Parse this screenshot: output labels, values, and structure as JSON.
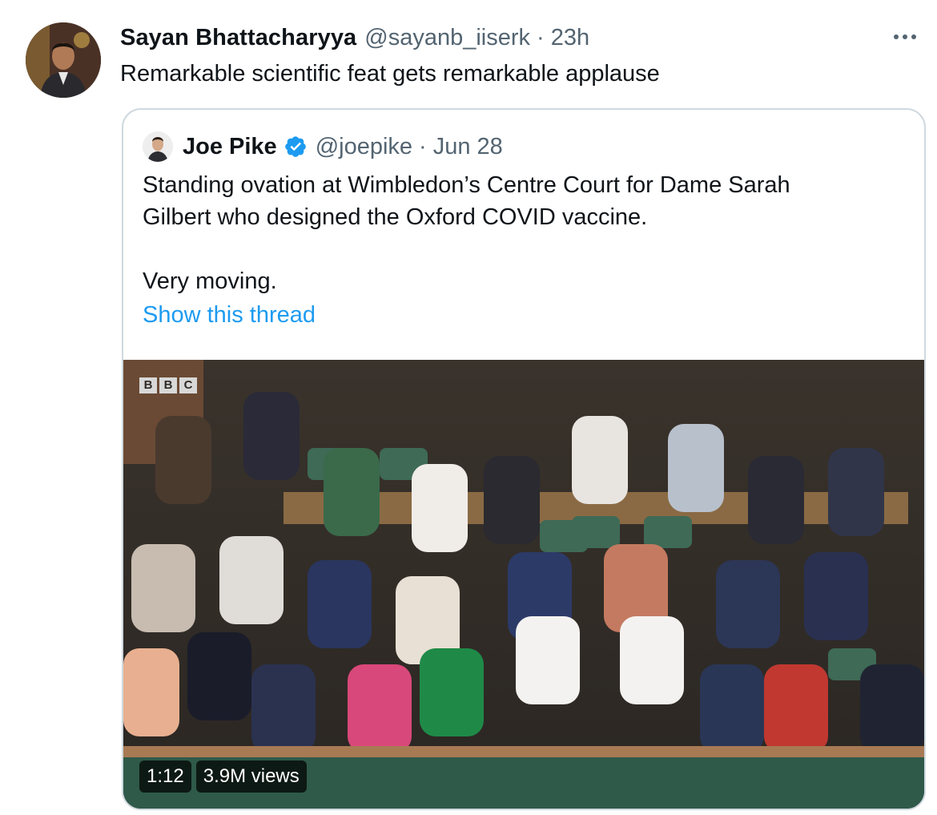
{
  "tweet": {
    "author_name": "Sayan Bhattacharyya",
    "author_handle": "@sayanb_iiserk",
    "separator": "·",
    "time": "23h",
    "text": "Remarkable scientific feat gets remarkable applause"
  },
  "quoted_tweet": {
    "author_name": "Joe Pike",
    "author_handle": "@joepike",
    "separator": "·",
    "date": "Jun 28",
    "text_line_1": "Standing ovation at Wimbledon’s Centre Court for Dame Sarah",
    "text_line_2": "Gilbert who designed the Oxford COVID vaccine.",
    "text_line_3": "Very moving.",
    "show_thread": "Show this thread",
    "video": {
      "logo": [
        "B",
        "B",
        "C"
      ],
      "duration": "1:12",
      "views": "3.9M views"
    }
  },
  "icons": {
    "more": "more-horizontal-icon",
    "verified": "verified-badge-icon"
  },
  "colors": {
    "link": "#1d9bf0",
    "secondary_text": "#536471",
    "verified": "#1d9bf0",
    "border": "#cfd9de"
  }
}
